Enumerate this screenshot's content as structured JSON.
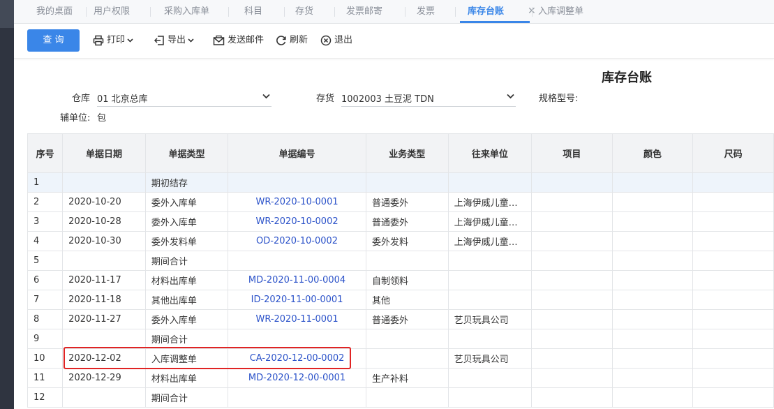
{
  "tabs": [
    {
      "label": "我的桌面"
    },
    {
      "label": "用户权限"
    },
    {
      "label": "采购入库单"
    },
    {
      "label": "科目"
    },
    {
      "label": "存货"
    },
    {
      "label": "发票邮寄"
    },
    {
      "label": "发票"
    },
    {
      "label": "库存台账"
    },
    {
      "label": "入库调整单"
    }
  ],
  "toolbar": {
    "query": "查 询",
    "print": "打印",
    "export": "导出",
    "email": "发送邮件",
    "refresh": "刷新",
    "exit": "退出"
  },
  "page": {
    "title": "库存台账"
  },
  "filters": {
    "warehouse_label": "仓库",
    "warehouse_value": "01 北京总库",
    "inventory_label": "存货",
    "inventory_value": "1002003 土豆泥 TDN",
    "spec_label": "规格型号:",
    "aux_unit_label": "辅单位:",
    "aux_unit_value": "包"
  },
  "table": {
    "headers": [
      "序号",
      "单据日期",
      "单据类型",
      "单据编号",
      "业务类型",
      "往来单位",
      "项目",
      "颜色",
      "尺码"
    ],
    "rows": [
      [
        "1",
        "",
        "期初结存",
        "",
        "",
        "",
        "",
        "",
        ""
      ],
      [
        "2",
        "2020-10-20",
        "委外入库单",
        "WR-2020-10-0001",
        "普通委外",
        "上海伊威儿童…",
        "",
        "",
        ""
      ],
      [
        "3",
        "2020-10-28",
        "委外入库单",
        "WR-2020-10-0002",
        "普通委外",
        "上海伊威儿童…",
        "",
        "",
        ""
      ],
      [
        "4",
        "2020-10-30",
        "委外发料单",
        "OD-2020-10-0002",
        "委外发料",
        "上海伊威儿童…",
        "",
        "",
        ""
      ],
      [
        "5",
        "",
        "期间合计",
        "",
        "",
        "",
        "",
        "",
        ""
      ],
      [
        "6",
        "2020-11-17",
        "材料出库单",
        "MD-2020-11-00-0004",
        "自制领料",
        "",
        "",
        "",
        ""
      ],
      [
        "7",
        "2020-11-18",
        "其他出库单",
        "ID-2020-11-00-0001",
        "其他",
        "",
        "",
        "",
        ""
      ],
      [
        "8",
        "2020-11-27",
        "委外入库单",
        "WR-2020-11-0001",
        "普通委外",
        "艺贝玩具公司",
        "",
        "",
        ""
      ],
      [
        "9",
        "",
        "期间合计",
        "",
        "",
        "",
        "",
        "",
        ""
      ],
      [
        "10",
        "2020-12-02",
        "入库调整单",
        "CA-2020-12-00-0002",
        "",
        "艺贝玩具公司",
        "",
        "",
        ""
      ],
      [
        "11",
        "2020-12-29",
        "材料出库单",
        "MD-2020-12-00-0001",
        "生产补料",
        "",
        "",
        "",
        ""
      ],
      [
        "12",
        "",
        "期间合计",
        "",
        "",
        "",
        "",
        "",
        ""
      ]
    ]
  },
  "colors": {
    "accent": "#3a86e8",
    "link": "#2b52c9",
    "highlight": "#e02424"
  }
}
